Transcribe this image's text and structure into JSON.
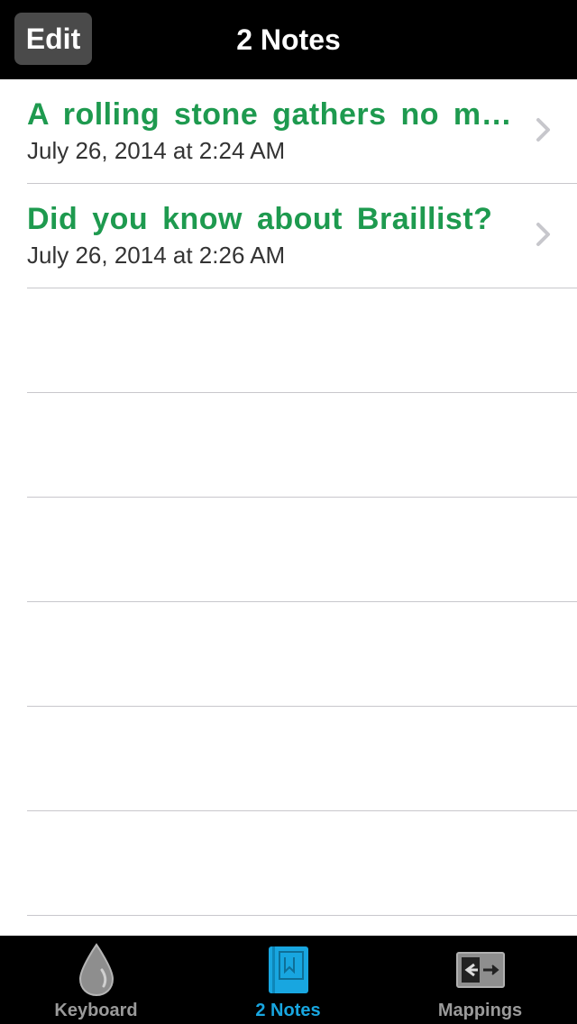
{
  "navbar": {
    "edit_label": "Edit",
    "title": "2 Notes"
  },
  "notes": [
    {
      "title": "A rolling stone gathers no moss",
      "date": "July 26, 2014 at 2:24 AM"
    },
    {
      "title": "Did you know about Braillist?",
      "date": "July 26, 2014 at 2:26 AM"
    }
  ],
  "colors": {
    "note_title": "#1e9a4f",
    "active_tab": "#18a6e0",
    "inactive_tab": "#9a9a9a"
  },
  "tabbar": {
    "tabs": [
      {
        "label": "Keyboard",
        "icon": "drop-icon",
        "active": false
      },
      {
        "label": "2 Notes",
        "icon": "book-icon",
        "active": true
      },
      {
        "label": "Mappings",
        "icon": "arrows-icon",
        "active": false
      }
    ]
  }
}
